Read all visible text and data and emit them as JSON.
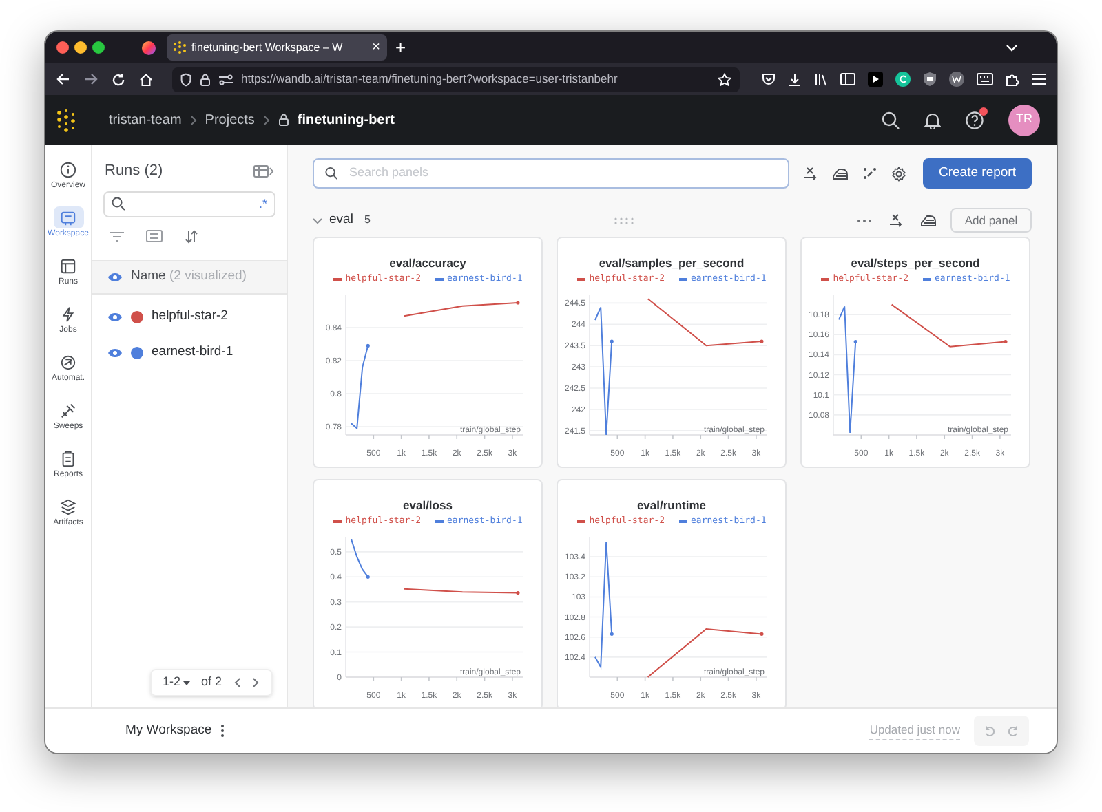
{
  "browser": {
    "tab_title": "finetuning-bert Workspace – W",
    "tab_close": "×",
    "new_tab": "+",
    "url": "https://wandb.ai/tristan-team/finetuning-bert?workspace=user-tristanbehr"
  },
  "header": {
    "breadcrumbs": [
      "tristan-team",
      "Projects",
      "finetuning-bert"
    ],
    "avatar": "TR",
    "notification": true
  },
  "nav": [
    {
      "label": "Overview",
      "selected": false
    },
    {
      "label": "Workspace",
      "selected": true
    },
    {
      "label": "Runs",
      "selected": false
    },
    {
      "label": "Jobs",
      "selected": false
    },
    {
      "label": "Automat.",
      "selected": false
    },
    {
      "label": "Sweeps",
      "selected": false
    },
    {
      "label": "Reports",
      "selected": false
    },
    {
      "label": "Artifacts",
      "selected": false
    }
  ],
  "runs_panel": {
    "title": "Runs (2)",
    "regex": ".*",
    "name_column": "Name",
    "visualized": "(2 visualized)",
    "runs": [
      {
        "name": "helpful-star-2",
        "color": "#d0504a",
        "visible": true
      },
      {
        "name": "earnest-bird-1",
        "color": "#4f7fdc",
        "visible": true
      }
    ],
    "pagination": {
      "range": "1-2",
      "total": "of 2"
    }
  },
  "toolbar": {
    "search_placeholder": "Search panels",
    "create_button": "Create report"
  },
  "section": {
    "name": "eval",
    "count": "5",
    "add_button": "Add panel",
    "panels": [
      {
        "chart_data": {
          "type": "line",
          "title": "eval/accuracy",
          "xlabel": "train/global_step",
          "grid": true,
          "legend": "top",
          "x": [
            100,
            200,
            300,
            400,
            1050,
            2100,
            3100
          ],
          "xlim": [
            0,
            3200
          ],
          "ylim": [
            0.775,
            0.86
          ],
          "xticks": [
            {
              "value": 500,
              "label": "500"
            },
            {
              "value": 1000,
              "label": "1k"
            },
            {
              "value": 1500,
              "label": "1.5k"
            },
            {
              "value": 2000,
              "label": "2k"
            },
            {
              "value": 2500,
              "label": "2.5k"
            },
            {
              "value": 3000,
              "label": "3k"
            }
          ],
          "yticks": [
            0.78,
            0.8,
            0.82,
            0.84
          ],
          "series": [
            {
              "name": "helpful-star-2",
              "color": "#d0504a",
              "values": [
                null,
                null,
                null,
                null,
                0.847,
                0.853,
                0.855
              ]
            },
            {
              "name": "earnest-bird-1",
              "color": "#4f7fdc",
              "values": [
                0.782,
                0.779,
                0.816,
                0.829,
                null,
                null,
                null
              ]
            }
          ]
        }
      },
      {
        "chart_data": {
          "type": "line",
          "title": "eval/samples_per_second",
          "xlabel": "train/global_step",
          "grid": true,
          "legend": "top",
          "x": [
            100,
            200,
            300,
            400,
            1050,
            2100,
            3100
          ],
          "xlim": [
            0,
            3200
          ],
          "ylim": [
            241.4,
            244.7
          ],
          "xticks": [
            {
              "value": 500,
              "label": "500"
            },
            {
              "value": 1000,
              "label": "1k"
            },
            {
              "value": 1500,
              "label": "1.5k"
            },
            {
              "value": 2000,
              "label": "2k"
            },
            {
              "value": 2500,
              "label": "2.5k"
            },
            {
              "value": 3000,
              "label": "3k"
            }
          ],
          "yticks": [
            {
              "value": 241.5,
              "label": "241.5"
            },
            {
              "value": 242,
              "label": "242"
            },
            {
              "value": 242.5,
              "label": "242.5"
            },
            {
              "value": 243,
              "label": "243"
            },
            {
              "value": 243.5,
              "label": "243.5"
            },
            {
              "value": 244,
              "label": "244"
            },
            {
              "value": 244.5,
              "label": "244.5"
            }
          ],
          "series": [
            {
              "name": "helpful-star-2",
              "color": "#d0504a",
              "values": [
                null,
                null,
                null,
                null,
                244.6,
                243.5,
                243.6
              ]
            },
            {
              "name": "earnest-bird-1",
              "color": "#4f7fdc",
              "values": [
                244.1,
                244.4,
                241.4,
                243.6,
                null,
                null,
                null
              ]
            }
          ]
        }
      },
      {
        "chart_data": {
          "type": "line",
          "title": "eval/steps_per_second",
          "xlabel": "train/global_step",
          "grid": true,
          "legend": "top",
          "x": [
            100,
            200,
            300,
            400,
            1050,
            2100,
            3100
          ],
          "xlim": [
            0,
            3200
          ],
          "ylim": [
            10.06,
            10.2
          ],
          "xticks": [
            {
              "value": 500,
              "label": "500"
            },
            {
              "value": 1000,
              "label": "1k"
            },
            {
              "value": 1500,
              "label": "1.5k"
            },
            {
              "value": 2000,
              "label": "2k"
            },
            {
              "value": 2500,
              "label": "2.5k"
            },
            {
              "value": 3000,
              "label": "3k"
            }
          ],
          "yticks": [
            {
              "value": 10.08,
              "label": "10.08"
            },
            {
              "value": 10.1,
              "label": "10.1"
            },
            {
              "value": 10.12,
              "label": "10.12"
            },
            {
              "value": 10.14,
              "label": "10.14"
            },
            {
              "value": 10.16,
              "label": "10.16"
            },
            {
              "value": 10.18,
              "label": "10.18"
            }
          ],
          "series": [
            {
              "name": "helpful-star-2",
              "color": "#d0504a",
              "values": [
                null,
                null,
                null,
                null,
                10.19,
                10.148,
                10.153
              ]
            },
            {
              "name": "earnest-bird-1",
              "color": "#4f7fdc",
              "values": [
                10.175,
                10.188,
                10.062,
                10.153,
                null,
                null,
                null
              ]
            }
          ]
        }
      },
      {
        "chart_data": {
          "type": "line",
          "title": "eval/loss",
          "xlabel": "train/global_step",
          "grid": true,
          "legend": "top",
          "x": [
            100,
            200,
            300,
            400,
            1050,
            2100,
            3100
          ],
          "xlim": [
            0,
            3200
          ],
          "ylim": [
            0,
            0.56
          ],
          "xticks": [
            {
              "value": 500,
              "label": "500"
            },
            {
              "value": 1000,
              "label": "1k"
            },
            {
              "value": 1500,
              "label": "1.5k"
            },
            {
              "value": 2000,
              "label": "2k"
            },
            {
              "value": 2500,
              "label": "2.5k"
            },
            {
              "value": 3000,
              "label": "3k"
            }
          ],
          "yticks": [
            0,
            0.1,
            0.2,
            0.3,
            0.4,
            0.5
          ],
          "series": [
            {
              "name": "helpful-star-2",
              "color": "#d0504a",
              "values": [
                null,
                null,
                null,
                null,
                0.352,
                0.34,
                0.336
              ]
            },
            {
              "name": "earnest-bird-1",
              "color": "#4f7fdc",
              "values": [
                0.55,
                0.48,
                0.43,
                0.4,
                null,
                null,
                null
              ]
            }
          ]
        }
      },
      {
        "chart_data": {
          "type": "line",
          "title": "eval/runtime",
          "xlabel": "train/global_step",
          "grid": true,
          "legend": "top",
          "x": [
            100,
            200,
            300,
            400,
            1050,
            2100,
            3100
          ],
          "xlim": [
            0,
            3200
          ],
          "ylim": [
            102.2,
            103.6
          ],
          "xticks": [
            {
              "value": 500,
              "label": "500"
            },
            {
              "value": 1000,
              "label": "1k"
            },
            {
              "value": 1500,
              "label": "1.5k"
            },
            {
              "value": 2000,
              "label": "2k"
            },
            {
              "value": 2500,
              "label": "2.5k"
            },
            {
              "value": 3000,
              "label": "3k"
            }
          ],
          "yticks": [
            {
              "value": 102.4,
              "label": "102.4"
            },
            {
              "value": 102.6,
              "label": "102.6"
            },
            {
              "value": 102.8,
              "label": "102.8"
            },
            {
              "value": 103,
              "label": "103"
            },
            {
              "value": 103.2,
              "label": "103.2"
            },
            {
              "value": 103.4,
              "label": "103.4"
            }
          ],
          "series": [
            {
              "name": "helpful-star-2",
              "color": "#d0504a",
              "values": [
                null,
                null,
                null,
                null,
                102.2,
                102.68,
                102.63
              ]
            },
            {
              "name": "earnest-bird-1",
              "color": "#4f7fdc",
              "values": [
                102.4,
                102.3,
                103.55,
                102.63,
                null,
                null,
                null
              ]
            }
          ]
        }
      }
    ]
  },
  "footer": {
    "workspace": "My Workspace",
    "status": "Updated just now"
  }
}
